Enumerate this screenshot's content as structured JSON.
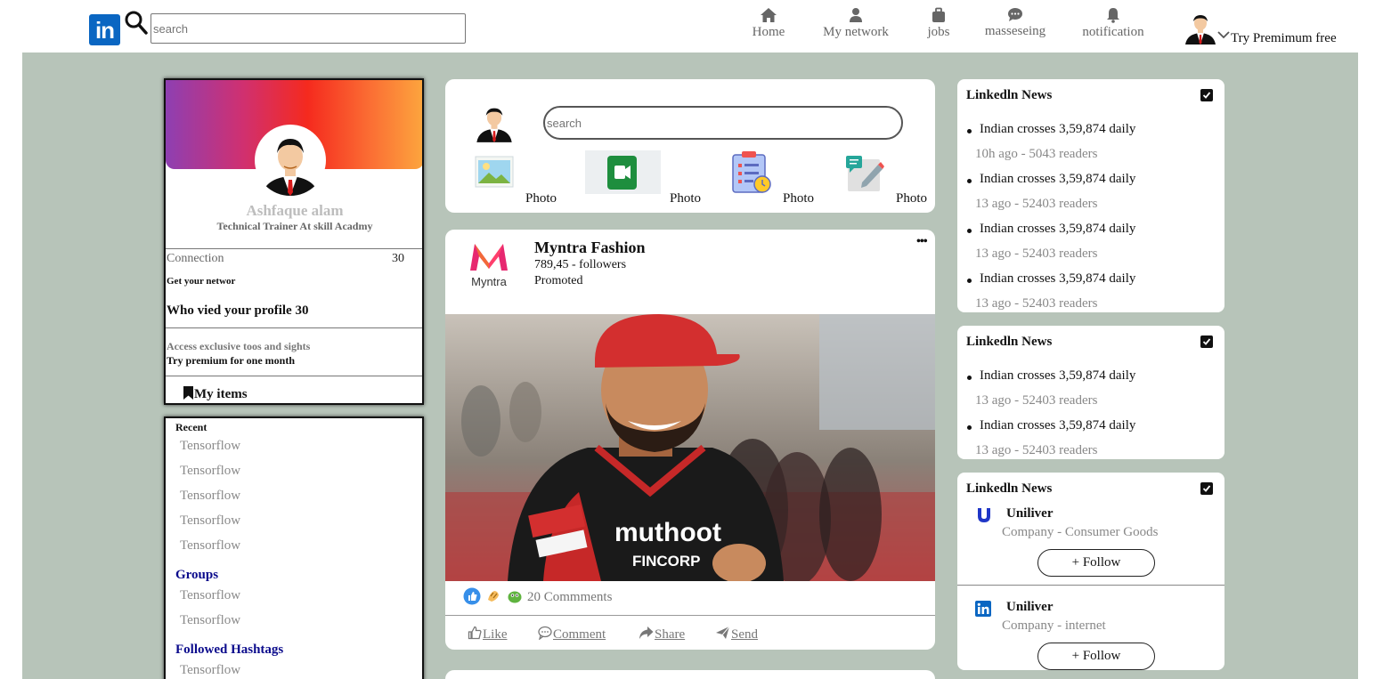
{
  "header": {
    "logo_text": "in",
    "search_placeholder": "search",
    "nav": [
      {
        "label": "Home",
        "icon": "home-icon"
      },
      {
        "label": "My network",
        "icon": "person-icon"
      },
      {
        "label": "jobs",
        "icon": "briefcase-icon"
      },
      {
        "label": "masseseing",
        "icon": "chat-icon"
      },
      {
        "label": "notification",
        "icon": "bell-icon"
      }
    ],
    "premium_label": "Try Premimum free"
  },
  "profile": {
    "name": "Ashfaque alam",
    "title": "Technical Trainer At skill Acadmy",
    "connection_label": "Connection",
    "connection_count": "30",
    "grow_network": "Get your networ",
    "who_viewed": "Who vied your profile 30",
    "access_text": "Access exclusive toos and sights",
    "try_premium": "Try premium for one month",
    "my_items": "My items"
  },
  "recent": {
    "title": "Recent",
    "items": [
      "Tensorflow",
      "Tensorflow",
      "Tensorflow",
      "Tensorflow",
      "Tensorflow"
    ],
    "groups_title": "Groups",
    "groups": [
      "Tensorflow",
      "Tensorflow"
    ],
    "hashtags_title": "Followed Hashtags",
    "hashtags": [
      "Tensorflow"
    ]
  },
  "compose": {
    "search_placeholder": "search",
    "actions": [
      "Photo",
      "Photo",
      "Photo",
      "Photo"
    ]
  },
  "post": {
    "author": "Myntra Fashion",
    "logo_text": "Myntra",
    "followers": "789,45 - followers",
    "promoted": "Promoted",
    "more": "•••",
    "jersey_brand": "muthoot",
    "jersey_sub": "FINCORP",
    "comments": "20 Commments",
    "actions": {
      "like": "Like",
      "comment": "Comment",
      "share": "Share",
      "send": "Send"
    }
  },
  "news_cards": [
    {
      "title": "Linkedln News",
      "items": [
        {
          "headline": "Indian crosses 3,59,874 daily",
          "meta": "10h ago - 5043 readers"
        },
        {
          "headline": "Indian crosses 3,59,874 daily",
          "meta": "13 ago - 52403 readers"
        },
        {
          "headline": "Indian crosses 3,59,874 daily",
          "meta": "13 ago - 52403 readers"
        },
        {
          "headline": "Indian crosses 3,59,874 daily",
          "meta": "13 ago - 52403 readers"
        }
      ]
    },
    {
      "title": "Linkedln News",
      "items": [
        {
          "headline": "Indian crosses 3,59,874 daily",
          "meta": "13 ago - 52403 readers"
        },
        {
          "headline": "Indian crosses 3,59,874 daily",
          "meta": "13 ago - 52403 readers"
        }
      ]
    },
    {
      "title": "Linkedln News",
      "companies": [
        {
          "name": "Uniliver",
          "meta": "Company - Consumer Goods",
          "logo": "unilever-logo-icon",
          "follow": "+ Follow"
        },
        {
          "name": "Uniliver",
          "meta": "Company - internet",
          "logo": "linkedin-logo-icon",
          "follow": "+ Follow"
        }
      ]
    }
  ],
  "colors": {
    "linkedin_blue": "#0a66c2",
    "page_bg": "#b7c4b9",
    "group_heading": "#0b0b8c"
  }
}
